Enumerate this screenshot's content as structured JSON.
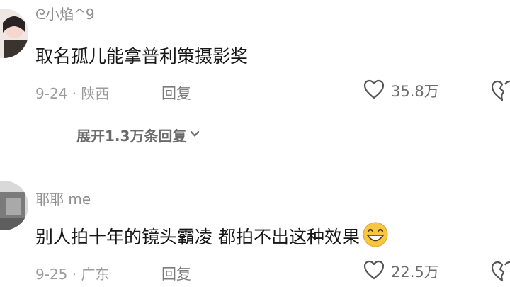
{
  "comments": [
    {
      "username": "ᘓ小焰^9",
      "text": "取名孤儿能拿普利策摄影奖",
      "date": "9-24",
      "location": "陕西",
      "reply_label": "回复",
      "likes": "35.8万",
      "replies_expand": "展开1.3万条回复"
    },
    {
      "username": "耶耶 me",
      "text": "别人拍十年的镜头霸凌 都拍不出这种效果",
      "emoji": "grinning-face-emoji",
      "date": "9-25",
      "location": "广东",
      "reply_label": "回复",
      "likes": "22.5万"
    }
  ],
  "colors": {
    "username": "#8f8f8f",
    "text": "#161616",
    "meta": "#9b9b9b",
    "reply": "#7c7c7c",
    "icon": "#555555"
  }
}
